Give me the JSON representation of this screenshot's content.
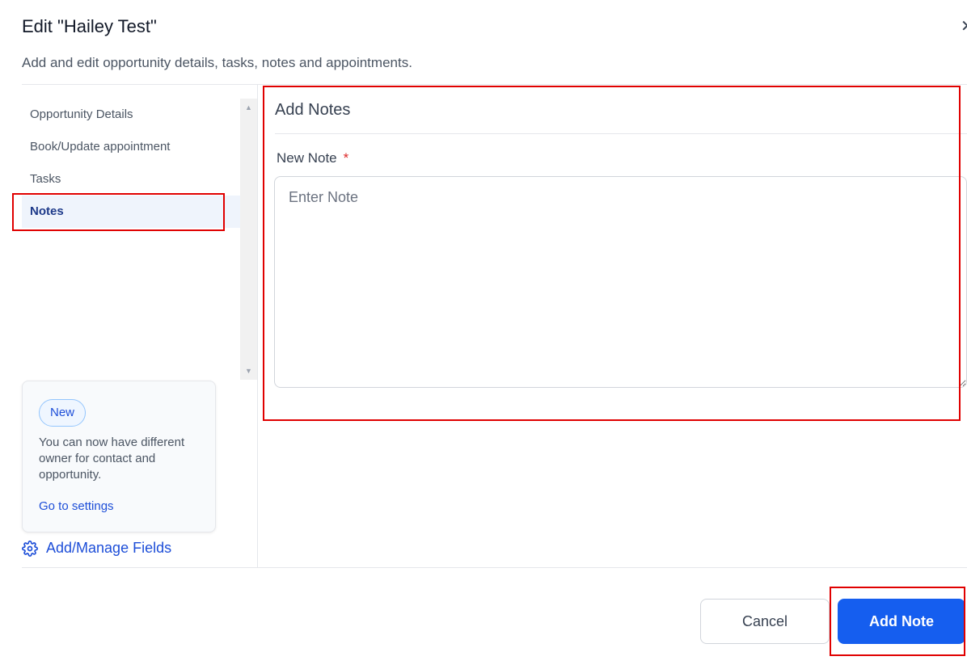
{
  "header": {
    "title": "Edit \"Hailey Test\"",
    "subtitle": "Add and edit opportunity details, tasks, notes and appointments.",
    "close_glyph": "✕"
  },
  "sidebar": {
    "items": [
      {
        "label": "Opportunity Details",
        "active": false
      },
      {
        "label": "Book/Update appointment",
        "active": false
      },
      {
        "label": "Tasks",
        "active": false
      },
      {
        "label": "Notes",
        "active": true
      }
    ]
  },
  "promo": {
    "badge": "New",
    "text": "You can now have different owner for contact and opportunity.",
    "link": "Go to settings"
  },
  "manage_fields": {
    "label": "Add/Manage Fields",
    "icon": "gear-icon"
  },
  "notes_panel": {
    "title": "Add Notes",
    "field_label": "New Note",
    "required_marker": "*",
    "placeholder": "Enter Note",
    "value": ""
  },
  "footer": {
    "cancel_label": "Cancel",
    "submit_label": "Add Note"
  },
  "colors": {
    "accent": "#155eef",
    "highlight": "#e00000",
    "link": "#1d4ed8"
  }
}
